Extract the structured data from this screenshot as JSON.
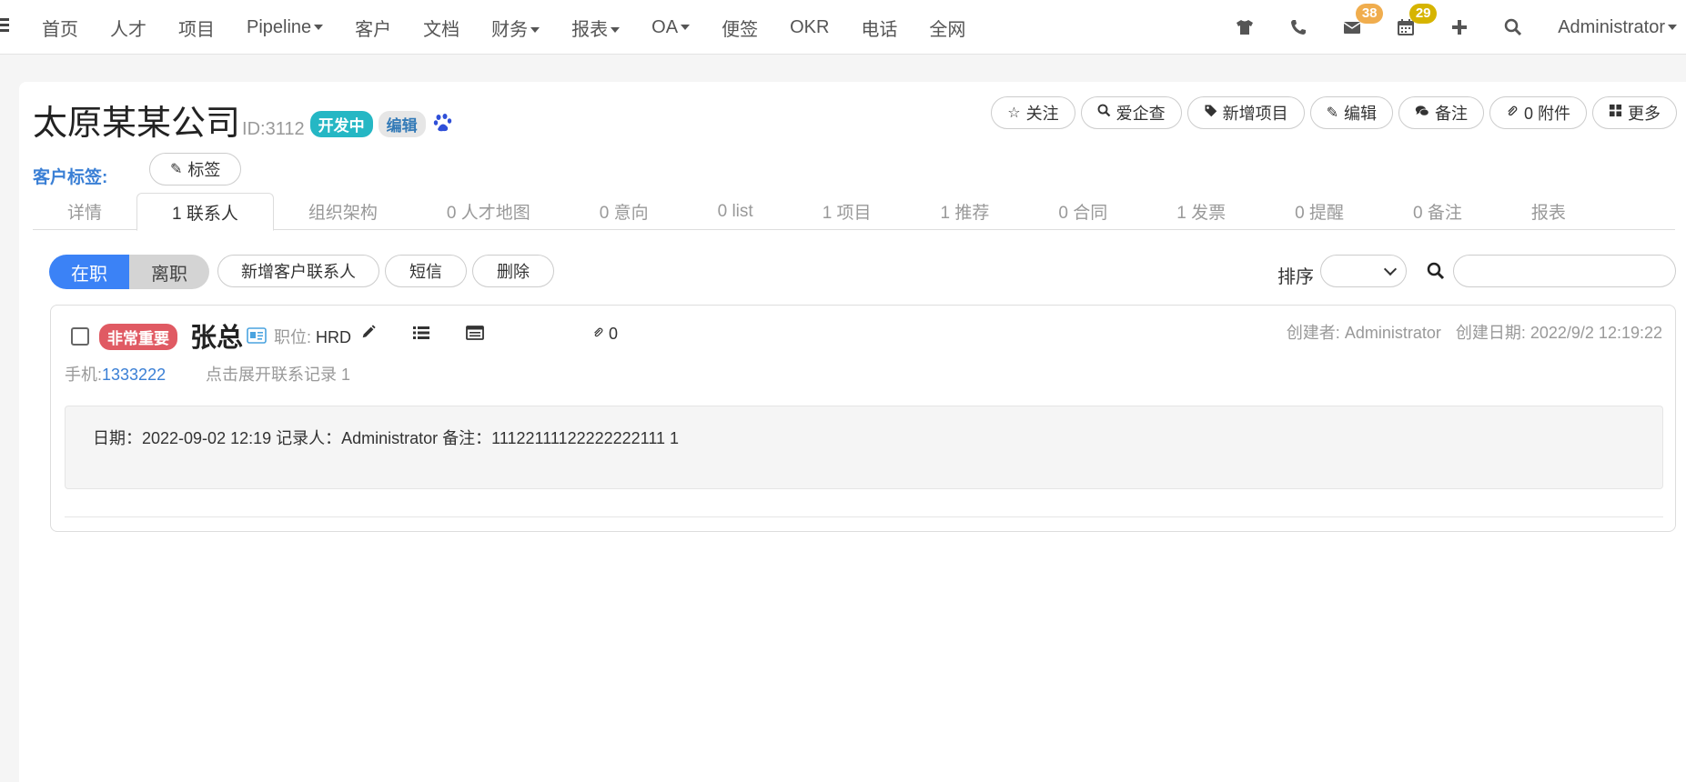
{
  "nav": {
    "items": [
      "首页",
      "人才",
      "项目",
      "Pipeline",
      "客户",
      "文档",
      "财务",
      "报表",
      "OA",
      "便签",
      "OKR",
      "电话",
      "全网"
    ],
    "dropdown_items": [
      "Pipeline",
      "财务",
      "报表",
      "OA"
    ],
    "mail_count": "38",
    "calendar_count": "29",
    "user": "Administrator",
    "icons": [
      "shirt-icon",
      "phone-icon",
      "mail-icon",
      "calendar-icon",
      "plus-icon",
      "search-icon"
    ]
  },
  "company": {
    "name": "太原某某公司",
    "id_text": "ID:3112",
    "status": "开发中",
    "edit_label": "编辑"
  },
  "actions": [
    {
      "icon": "star-icon",
      "label": "关注"
    },
    {
      "icon": "search-icon",
      "label": "爱企查"
    },
    {
      "icon": "tag-icon",
      "label": "新增项目"
    },
    {
      "icon": "pencil-icon",
      "label": "编辑"
    },
    {
      "icon": "comments-icon",
      "label": "备注"
    },
    {
      "icon": "paperclip-icon",
      "label": "0 附件"
    },
    {
      "icon": "grid-icon",
      "label": "更多"
    }
  ],
  "tags": {
    "label": "客户标签:",
    "button_label": "标签"
  },
  "tabs": [
    "详情",
    "1 联系人",
    "组织架构",
    "0 人才地图",
    "0 意向",
    "0 list",
    "1 项目",
    "1 推荐",
    "0 合同",
    "1 发票",
    "0 提醒",
    "0 备注",
    "报表"
  ],
  "active_tab": "1 联系人",
  "toolbar": {
    "seg_on": "在职",
    "seg_off": "离职",
    "add_contact": "新增客户联系人",
    "sms": "短信",
    "delete": "删除",
    "sort_label": "排序",
    "sort_value": "",
    "search_value": ""
  },
  "contact": {
    "importance": "非常重要",
    "name": "张总",
    "position_label": "职位:",
    "position": "HRD",
    "attachments": "0",
    "creator": "创建者: Administrator",
    "created_at": "创建日期: 2022/9/2 12:19:22",
    "phone_label": "手机:",
    "phone": "1333222",
    "expand_label": "点击展开联系记录 1",
    "record": "日期：2022-09-02 12:19 记录人：Administrator 备注：11122111122222222111 1"
  },
  "colors": {
    "primary": "#3b82f6",
    "status_teal": "#25b7c4",
    "importance_red": "#e05a63",
    "badge_orange": "#f0ad4e",
    "badge_yellow": "#d6b400",
    "label_blue": "#3a7fd5"
  }
}
